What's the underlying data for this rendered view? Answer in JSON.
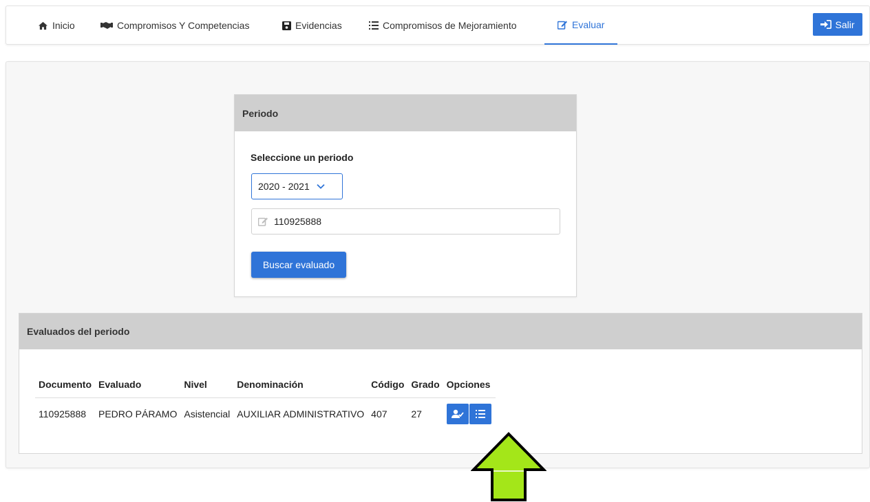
{
  "nav": {
    "items": [
      {
        "label": "Inicio",
        "icon": "home-icon"
      },
      {
        "label": "Compromisos Y Competencias",
        "icon": "handshake-icon"
      },
      {
        "label": "Evidencias",
        "icon": "save-icon"
      },
      {
        "label": "Compromisos de Mejoramiento",
        "icon": "list-icon"
      },
      {
        "label": "Evaluar",
        "icon": "edit-icon"
      }
    ],
    "active": "Evaluar",
    "logout_label": "Salir"
  },
  "periodo": {
    "header": "Periodo",
    "select_label": "Seleccione un periodo",
    "selected": "2020 - 2021",
    "document_value": "110925888",
    "search_button": "Buscar evaluado"
  },
  "evaluados": {
    "header": "Evaluados del periodo",
    "columns": [
      "Documento",
      "Evaluado",
      "Nivel",
      "Denominación",
      "Código",
      "Grado",
      "Opciones"
    ],
    "rows": [
      [
        "110925888",
        "PEDRO PÁRAMO",
        "Asistencial",
        "AUXILIAR ADMINISTRATIVO",
        "407",
        "27"
      ]
    ]
  },
  "colors": {
    "primary": "#2f74d8",
    "header_bg": "#cfcfcf",
    "arrow_fill": "#a4e619"
  }
}
